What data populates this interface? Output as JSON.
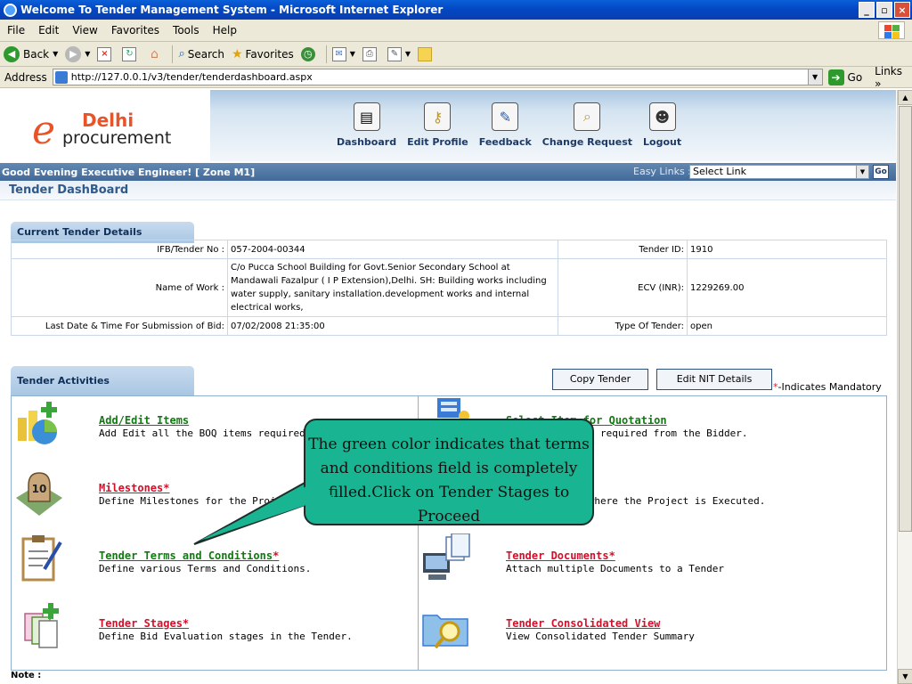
{
  "window": {
    "title": "Welcome To Tender Management System - Microsoft Internet Explorer",
    "minimize": "_",
    "maximize": "▫",
    "close": "×"
  },
  "menu": [
    "File",
    "Edit",
    "View",
    "Favorites",
    "Tools",
    "Help"
  ],
  "toolbar": {
    "back": "Back",
    "search": "Search",
    "favorites": "Favorites"
  },
  "address": {
    "label": "Address",
    "url": "http://127.0.0.1/v3/tender/tenderdashboard.aspx",
    "go": "Go",
    "links": "Links"
  },
  "logo": {
    "e": "e",
    "city": "Delhi",
    "word": "procurement"
  },
  "nav": [
    {
      "label": "Dashboard",
      "icon": "clipboard-icon"
    },
    {
      "label": "Edit Profile",
      "icon": "key-icon"
    },
    {
      "label": "Feedback",
      "icon": "pencil-icon"
    },
    {
      "label": "Change Request",
      "icon": "search-page-icon"
    },
    {
      "label": "Logout",
      "icon": "user-icon"
    }
  ],
  "greeting": "Good Evening Executive Engineer!  [ Zone M1]",
  "easy_links": {
    "label": "Easy Links :",
    "selected": "Select Link",
    "go": "Go"
  },
  "dashboard_title": "Tender DashBoard",
  "current_tender": {
    "heading": "Current Tender Details",
    "rows": [
      {
        "label": "IFB/Tender No :",
        "value": "057-2004-00344",
        "label2": "Tender ID:",
        "value2": "1910"
      },
      {
        "label": "Name of Work :",
        "value": "C/o Pucca School Building for Govt.Senior Secondary School at Mandawali Fazalpur ( I P Extension),Delhi. SH: Building works including water supply, sanitary installation.development works and internal electrical works,",
        "label2": "ECV (INR):",
        "value2": "1229269.00"
      },
      {
        "label": "Last Date & Time For Submission of Bid:",
        "value": "07/02/2008 21:35:00",
        "label2": "Type Of Tender:",
        "value2": "open"
      }
    ]
  },
  "activities_section": {
    "heading": "Tender Activities",
    "copy_button": "Copy Tender",
    "edit_nit_button": "Edit NIT Details",
    "mandatory_star": "*",
    "mandatory_text": "-Indicates Mandatory"
  },
  "activities": [
    {
      "title": "Add/Edit Items",
      "mandatory": "",
      "desc": "Add Edit all the BOQ items required for the",
      "color": "#117a11"
    },
    {
      "title": "Select Item for Quotation",
      "mandatory": "",
      "desc": "se Quotation is required from the Bidder.",
      "color": "#117a11"
    },
    {
      "title": "Milestones",
      "mandatory": "*",
      "desc": "Define Milestones for the Project",
      "color": "#d3112b"
    },
    {
      "title": "articulars",
      "mandatory": "",
      "desc": "ical Location where the Project is Executed.",
      "color": "#d3112b"
    },
    {
      "title": "Tender Terms and Conditions",
      "mandatory": "*",
      "desc": "Define various Terms and Conditions.",
      "color": "#117a11"
    },
    {
      "title": "Tender Documents",
      "mandatory": "*",
      "desc": "Attach multiple Documents to a Tender",
      "color": "#d3112b"
    },
    {
      "title": "Tender Stages",
      "mandatory": "*",
      "desc": "Define Bid Evaluation stages in the Tender.",
      "color": "#d3112b"
    },
    {
      "title": "Tender Consolidated View",
      "mandatory": "",
      "desc": "View Consolidated Tender Summary",
      "color": "#d3112b"
    }
  ],
  "callout": {
    "text": "The green color indicates that terms and conditions field is completely filled.Click on Tender Stages  to Proceed"
  },
  "note": "Note :"
}
